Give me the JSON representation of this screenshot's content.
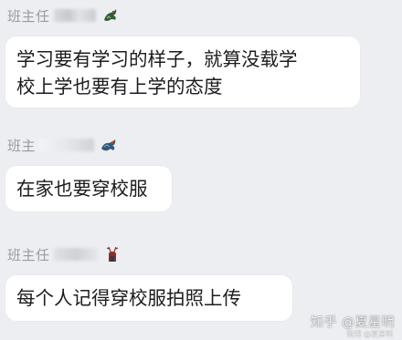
{
  "colors": {
    "background": "#eceef2",
    "bubble": "#ffffff",
    "sender_text": "#9a9ca2",
    "message_text": "#1c1c1c"
  },
  "messages": [
    {
      "sender": "班主任",
      "sender_visible": "班主任",
      "text_line1": "学习要有学习的样子，就算没载学",
      "text_line2": "校上学也要有上学的态度",
      "avatar_icon": "dragon-sticker-icon"
    },
    {
      "sender": "班主",
      "sender_visible": "班主",
      "text_line1": "在家也要穿校服",
      "avatar_icon": "dragon-sticker-icon"
    },
    {
      "sender": "班主任",
      "sender_visible": "班主任",
      "text_line1": "每个人记得穿校服拍照上传",
      "avatar_icon": "deer-sticker-icon"
    }
  ],
  "watermark": {
    "text": "知乎 @夏星明",
    "sub": "微博 @夏星明"
  }
}
